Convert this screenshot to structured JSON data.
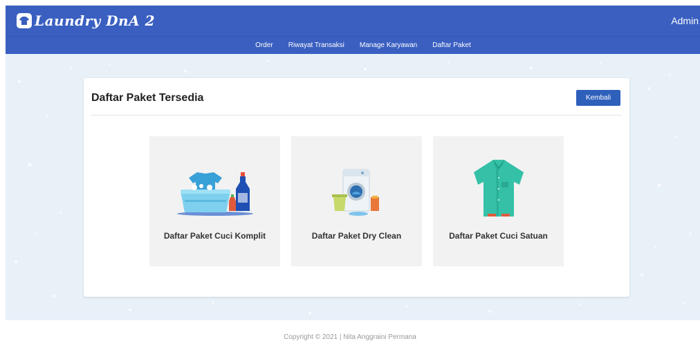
{
  "app": {
    "title": "Laundry DnA 2",
    "user": "Admin"
  },
  "nav": {
    "items": [
      "Order",
      "Riwayat Transaksi",
      "Manage Karyawan",
      "Daftar Paket"
    ]
  },
  "main": {
    "title": "Daftar Paket Tersedia",
    "back_label": "Kembali",
    "packages": [
      {
        "label": "Daftar Paket Cuci Komplit",
        "icon": "laundry-basin-icon"
      },
      {
        "label": "Daftar Paket Dry Clean",
        "icon": "washing-machine-icon"
      },
      {
        "label": "Daftar Paket Cuci Satuan",
        "icon": "shirt-icon"
      }
    ]
  },
  "footer": {
    "text": "Copyright © 2021 | Nita Anggraini Permana"
  },
  "colors": {
    "header": "#3a5fc1",
    "button": "#2e5fbb",
    "page_bg": "#e8f1f8",
    "tile_bg": "#f2f2f2"
  }
}
